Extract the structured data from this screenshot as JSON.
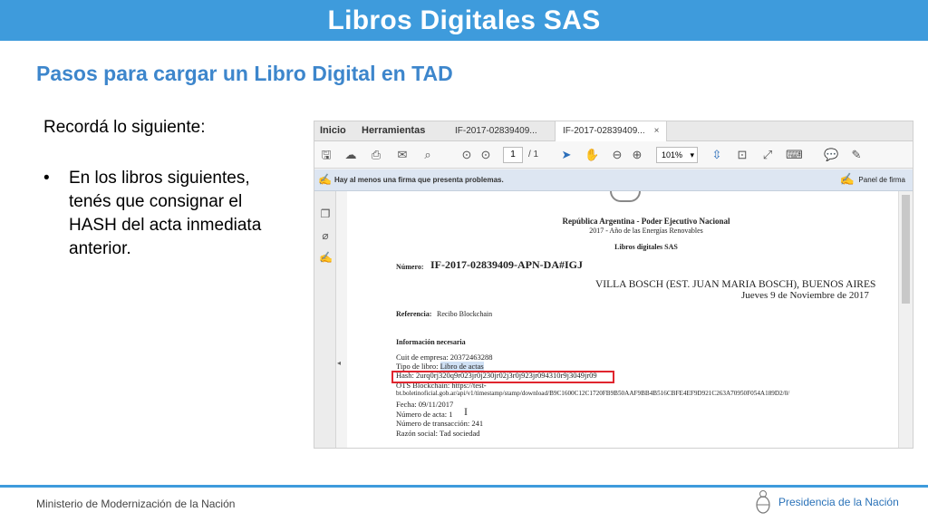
{
  "slide": {
    "title": "Libros Digitales SAS",
    "subtitle": "Pasos para cargar un Libro Digital en TAD",
    "intro": "Recordá lo siguiente:",
    "bullet_symbol": "•",
    "bullet_text": "En los libros siguientes, tenés que consignar el HASH del acta inmediata anterior.",
    "footer_left": "Ministerio de Modernización de la Nación",
    "footer_right": "Presidencia de la Nación",
    "accent_color": "#3e9bdc",
    "subtitle_color": "#3d86cc"
  },
  "app": {
    "menu": {
      "inicio": "Inicio",
      "herramientas": "Herramientas"
    },
    "tabs": [
      {
        "label": "IF-2017-02839409...",
        "close": ""
      },
      {
        "label": "IF-2017-02839409...",
        "close": "×"
      }
    ],
    "toolbar": {
      "icons": [
        "save-icon",
        "upload-icon",
        "print-icon",
        "email-icon",
        "search-icon",
        "page-up-icon",
        "page-down-icon",
        "select-arrow-icon",
        "hand-icon",
        "zoom-out-icon",
        "zoom-in-icon",
        "fit-page-icon",
        "fit-width-icon",
        "rotate-icon",
        "fullscreen-icon",
        "keyboard-icon",
        "comment-icon",
        "pen-icon"
      ],
      "page_current": "1",
      "page_total": "/ 1",
      "zoom": "101%"
    },
    "signature_bar": {
      "message": "Hay al menos una firma que presenta problemas.",
      "panel_label": "Panel de firma"
    },
    "document": {
      "header_line1": "República Argentina - Poder Ejecutivo Nacional",
      "header_line2": "2017 - Año de las Energías Renovables",
      "header_line3": "Libros digitales SAS",
      "numero_label": "Número:",
      "numero_value": "IF-2017-02839409-APN-DA#IGJ",
      "location": "VILLA BOSCH (EST. JUAN MARIA BOSCH), BUENOS AIRES",
      "date": "Jueves 9 de Noviembre de 2017",
      "referencia_label": "Referencia:",
      "referencia_value": "Recibo Blockchain",
      "info_heading": "Información necesaria",
      "cuit": "Cuit de empresa: 20372463288",
      "tipo_label": "Tipo de libro: ",
      "tipo_value": "Libro de actas",
      "hash": "Hash: 2urq0rj320q9r023jr0j230jr02j3r0j923jr094310r9j3049jr09",
      "ots_line1": "OTS Blockchain: https://test-",
      "ots_line2": "bt.boletinoficial.gob.ar/api/v1/timestamp/stamp/download/B9C1600C12C1720FB9B50AAF9BB4B516CBFE4EF9D921C263A70950F054A189D2/0/",
      "fecha": "Fecha: 09/11/2017",
      "numero_acta": "Número de acta: 1",
      "numero_transaccion": "Número de transacción: 241",
      "razon_social": "Razón social: Tad sociedad",
      "cursor_glyph": "I"
    }
  }
}
